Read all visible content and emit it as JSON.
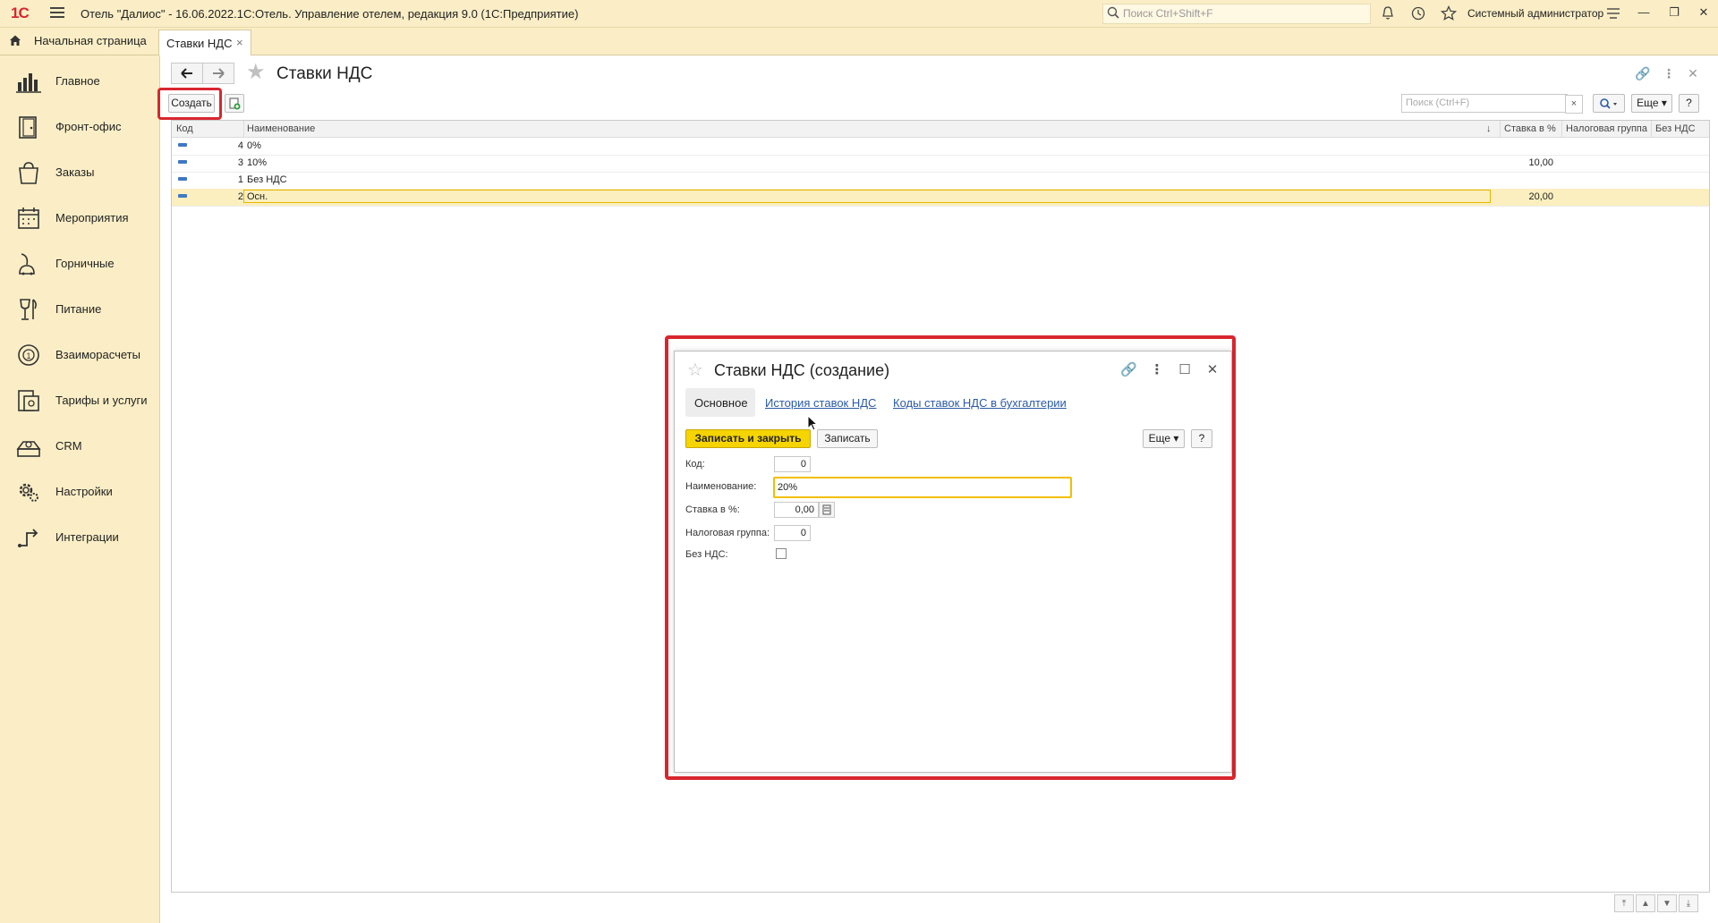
{
  "app": {
    "logo": "1С",
    "window_title": "Отель \"Далиос\" - 16.06.2022.1С:Отель. Управление отелем, редакция 9.0  (1С:Предприятие)",
    "search_placeholder": "Поиск Ctrl+Shift+F",
    "user_name": "Системный администратор"
  },
  "tabs": {
    "home": "Начальная страница",
    "active": "Ставки НДС"
  },
  "sidebar": {
    "items": [
      {
        "label": "Главное",
        "icon": "bar-chart-icon"
      },
      {
        "label": "Фронт-офис",
        "icon": "door-icon"
      },
      {
        "label": "Заказы",
        "icon": "shopping-bag-icon"
      },
      {
        "label": "Мероприятия",
        "icon": "calendar-icon"
      },
      {
        "label": "Горничные",
        "icon": "vacuum-icon"
      },
      {
        "label": "Питание",
        "icon": "glass-icon"
      },
      {
        "label": "Взаиморасчеты",
        "icon": "coin-icon"
      },
      {
        "label": "Тарифы и услуги",
        "icon": "price-list-icon"
      },
      {
        "label": "CRM",
        "icon": "crm-icon"
      },
      {
        "label": "Настройки",
        "icon": "gear-icon"
      },
      {
        "label": "Интеграции",
        "icon": "integration-icon"
      }
    ]
  },
  "list": {
    "title": "Ставки НДС",
    "create_label": "Создать",
    "search_placeholder": "Поиск (Ctrl+F)",
    "more_label": "Еще",
    "help_label": "?",
    "columns": [
      "Код",
      "Наименование",
      "Ставка в %",
      "Налоговая группа",
      "Без НДС"
    ],
    "sort_indicator": "↓",
    "rows": [
      {
        "code": "4",
        "name": "0%",
        "rate": ""
      },
      {
        "code": "3",
        "name": "10%",
        "rate": "10,00"
      },
      {
        "code": "1",
        "name": "Без НДС",
        "rate": ""
      },
      {
        "code": "2",
        "name": "Осн.",
        "rate": "20,00"
      }
    ]
  },
  "dialog": {
    "title": "Ставки НДС (создание)",
    "tabs": [
      "Основное",
      "История ставок НДС",
      "Коды ставок НДС в бухгалтерии"
    ],
    "save_close_label": "Записать и закрыть",
    "save_label": "Записать",
    "more_label": "Еще",
    "help_label": "?",
    "fields": {
      "code_label": "Код:",
      "code_value": "0",
      "name_label": "Наименование:",
      "name_value": "20%",
      "rate_label": "Ставка в %:",
      "rate_value": "0,00",
      "tax_group_label": "Налоговая группа:",
      "tax_group_value": "0",
      "no_vat_label": "Без НДС:"
    }
  },
  "colors": {
    "accent_red": "#d8262f",
    "panel_bg": "#fbeec6",
    "primary_button": "#f5d400",
    "selection_row": "#fbefbf",
    "link": "#2a5aa5"
  }
}
